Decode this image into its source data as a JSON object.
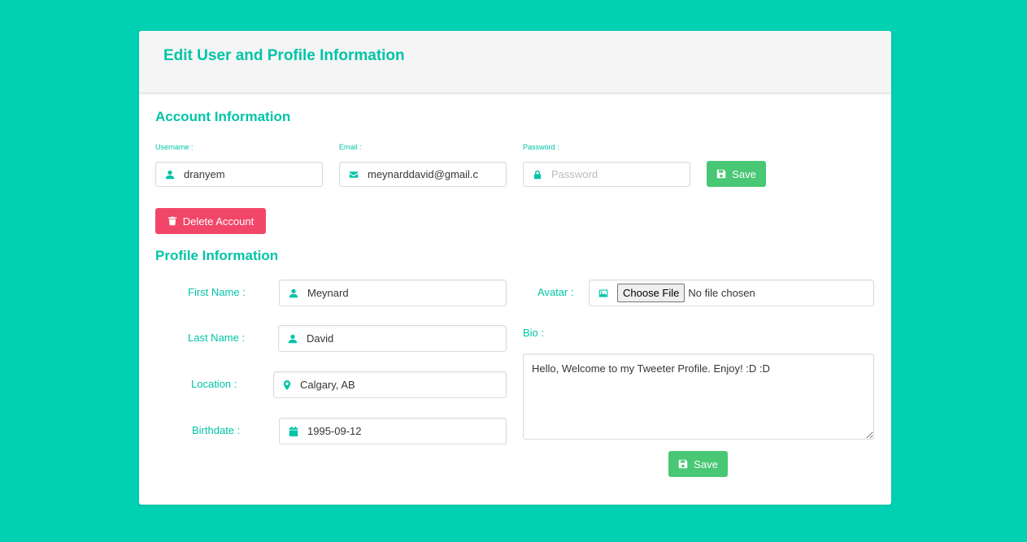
{
  "page": {
    "title": "Edit User and Profile Information",
    "background_color": "#00d1b2",
    "accent_color": "#00c4a7"
  },
  "account": {
    "section_title": "Account Information",
    "username": {
      "label": "Username :",
      "value": "dranyem",
      "icon": "user-icon"
    },
    "email": {
      "label": "Email :",
      "value": "meynarddavid@gmail.c",
      "icon": "envelope-icon"
    },
    "password": {
      "label": "Password :",
      "value": "",
      "placeholder": "Password",
      "icon": "lock-icon"
    },
    "save_label": "Save",
    "delete_label": "Delete Account",
    "save_color": "#48c774",
    "delete_color": "#f14668"
  },
  "profile": {
    "section_title": "Profile Information",
    "first_name": {
      "label": "First Name :",
      "value": "Meynard",
      "icon": "user-icon"
    },
    "last_name": {
      "label": "Last Name :",
      "value": "David",
      "icon": "user-icon"
    },
    "location": {
      "label": "Location :",
      "value": "Calgary, AB",
      "icon": "map-marker-icon"
    },
    "birthdate": {
      "label": "Birthdate :",
      "value": "1995-09-12",
      "icon": "calendar-icon"
    },
    "avatar": {
      "label": "Avatar :",
      "button_label": "Choose File",
      "status": "No file chosen",
      "icon": "image-icon"
    },
    "bio": {
      "label": "Bio :",
      "value": "Hello, Welcome to my Tweeter Profile. Enjoy! :D :D"
    },
    "save_label": "Save"
  }
}
